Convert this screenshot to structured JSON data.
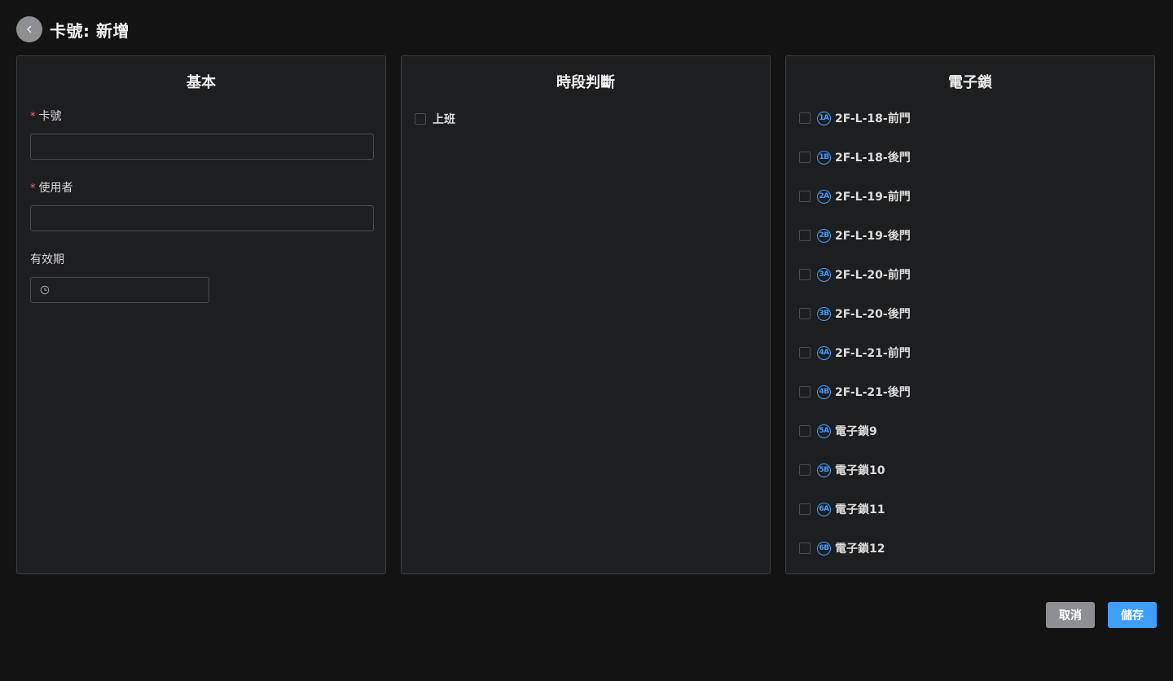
{
  "header": {
    "title": "卡號: 新增"
  },
  "basic": {
    "title": "基本",
    "card_label": "卡號",
    "card_required": "*",
    "card_value": "",
    "user_label": "使用者",
    "user_required": "*",
    "user_value": "",
    "validity_label": "有效期"
  },
  "schedule": {
    "title": "時段判斷",
    "items": [
      {
        "label": "上班",
        "checked": false
      }
    ]
  },
  "locks": {
    "title": "電子鎖",
    "items": [
      {
        "badge": "1A",
        "label": "2F-L-18-前門",
        "checked": false
      },
      {
        "badge": "1B",
        "label": "2F-L-18-後門",
        "checked": false
      },
      {
        "badge": "2A",
        "label": "2F-L-19-前門",
        "checked": false
      },
      {
        "badge": "2B",
        "label": "2F-L-19-後門",
        "checked": false
      },
      {
        "badge": "3A",
        "label": "2F-L-20-前門",
        "checked": false
      },
      {
        "badge": "3B",
        "label": "2F-L-20-後門",
        "checked": false
      },
      {
        "badge": "4A",
        "label": "2F-L-21-前門",
        "checked": false
      },
      {
        "badge": "4B",
        "label": "2F-L-21-後門",
        "checked": false
      },
      {
        "badge": "5A",
        "label": "電子鎖9",
        "checked": false
      },
      {
        "badge": "5B",
        "label": "電子鎖10",
        "checked": false
      },
      {
        "badge": "6A",
        "label": "電子鎖11",
        "checked": false
      },
      {
        "badge": "6B",
        "label": "電子鎖12",
        "checked": false
      }
    ]
  },
  "footer": {
    "cancel_label": "取消",
    "save_label": "儲存"
  },
  "colors": {
    "background": "#131314",
    "panel": "#1d1e20",
    "border": "#3c3d40",
    "primary": "#409eff",
    "secondary": "#8e8f93",
    "required": "#f56c6c"
  },
  "icons": {
    "back": "chevron-left-icon",
    "date": "clock-icon"
  }
}
